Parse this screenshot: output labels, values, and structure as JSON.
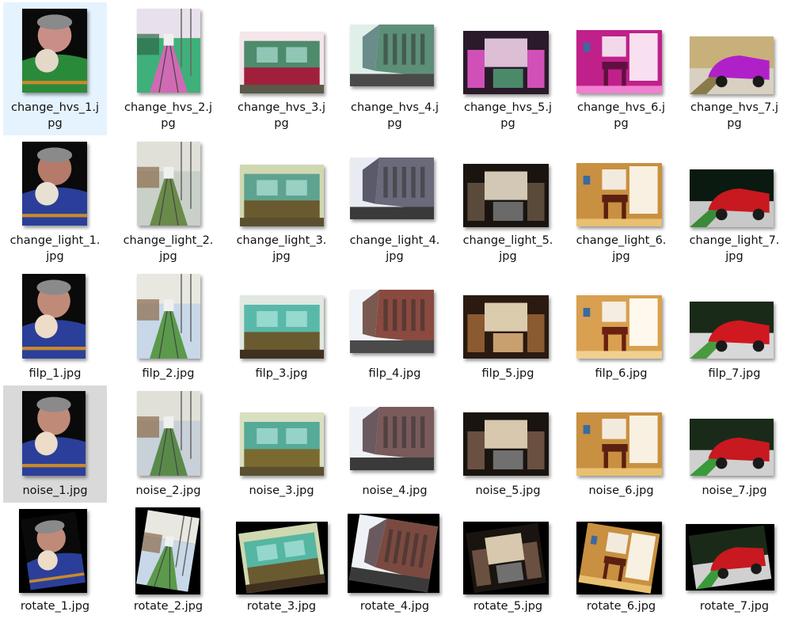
{
  "files": [
    {
      "name": "change_hvs_1.j\npg",
      "selected": true,
      "hover": false,
      "thumb": {
        "type": "portrait",
        "colors": [
          "#0a0a0a",
          "#2a8a3a",
          "#c98f86",
          "#e4d8c8"
        ]
      }
    },
    {
      "name": "change_hvs_2.j\npg",
      "selected": false,
      "hover": false,
      "thumb": {
        "type": "railway",
        "colors": [
          "#3fb07a",
          "#d06ab4",
          "#2f6a4a",
          "#e8e0ea"
        ]
      }
    },
    {
      "name": "change_hvs_3.j\npg",
      "selected": false,
      "hover": false,
      "thumb": {
        "type": "house",
        "colors": [
          "#f4e6ea",
          "#a0203c",
          "#2f7a56",
          "#5a5a4a"
        ]
      }
    },
    {
      "name": "change_hvs_4.j\npg",
      "selected": false,
      "hover": false,
      "thumb": {
        "type": "street",
        "colors": [
          "#dff0e8",
          "#5d8f78",
          "#6a8c8a",
          "#4a4a4a"
        ]
      }
    },
    {
      "name": "change_hvs_5.j\npg",
      "selected": false,
      "hover": false,
      "thumb": {
        "type": "room",
        "colors": [
          "#2a1a2a",
          "#d050b8",
          "#f0d0e8",
          "#4a8a6a"
        ]
      }
    },
    {
      "name": "change_hvs_6.j\npg",
      "selected": false,
      "hover": false,
      "thumb": {
        "type": "dining",
        "colors": [
          "#c0208a",
          "#f080d0",
          "#f8e0f0",
          "#601040"
        ]
      }
    },
    {
      "name": "change_hvs_7.j\npg",
      "selected": false,
      "hover": false,
      "thumb": {
        "type": "car",
        "colors": [
          "#c8b07a",
          "#b020c8",
          "#8a7a4a",
          "#d8d0c0"
        ]
      }
    },
    {
      "name": "change_light_1.\njpg",
      "selected": false,
      "hover": false,
      "thumb": {
        "type": "portrait",
        "colors": [
          "#0a0a0a",
          "#2b3f9a",
          "#b57a6a",
          "#e8e0d0"
        ]
      }
    },
    {
      "name": "change_light_2.\njpg",
      "selected": false,
      "hover": false,
      "thumb": {
        "type": "railway",
        "colors": [
          "#c8d0c8",
          "#6a8a4a",
          "#8a6a4a",
          "#e0e0d8"
        ]
      }
    },
    {
      "name": "change_light_3.\njpg",
      "selected": false,
      "hover": false,
      "thumb": {
        "type": "house",
        "colors": [
          "#d0d8b0",
          "#6a5a30",
          "#4a9a8a",
          "#5a5030"
        ]
      }
    },
    {
      "name": "change_light_4.\njpg",
      "selected": false,
      "hover": false,
      "thumb": {
        "type": "street",
        "colors": [
          "#e8ecf2",
          "#6a6a7a",
          "#5a5a6a",
          "#3a3a3a"
        ]
      }
    },
    {
      "name": "change_light_5.\njpg",
      "selected": false,
      "hover": false,
      "thumb": {
        "type": "room",
        "colors": [
          "#1a1410",
          "#5a4a3a",
          "#e8dcc8",
          "#6a6a6a"
        ]
      }
    },
    {
      "name": "change_light_6.\njpg",
      "selected": false,
      "hover": false,
      "thumb": {
        "type": "dining",
        "colors": [
          "#c89040",
          "#e8c070",
          "#f8f0e0",
          "#5a2010"
        ]
      }
    },
    {
      "name": "change_light_7.\njpg",
      "selected": false,
      "hover": false,
      "thumb": {
        "type": "car",
        "colors": [
          "#0a1a10",
          "#c81820",
          "#3a8a3a",
          "#c8c8c8"
        ]
      }
    },
    {
      "name": "filp_1.jpg",
      "selected": false,
      "hover": false,
      "thumb": {
        "type": "portrait",
        "colors": [
          "#0a0a0a",
          "#2b3f9a",
          "#c08a78",
          "#ecdcc8"
        ]
      }
    },
    {
      "name": "filp_2.jpg",
      "selected": false,
      "hover": false,
      "thumb": {
        "type": "railway",
        "colors": [
          "#c8d8e8",
          "#5a9a4a",
          "#8a6a4a",
          "#e8e8e0"
        ]
      }
    },
    {
      "name": "filp_3.jpg",
      "selected": false,
      "hover": false,
      "thumb": {
        "type": "house",
        "colors": [
          "#e0e8e0",
          "#6a5a30",
          "#40b0a0",
          "#403020"
        ]
      }
    },
    {
      "name": "filp_4.jpg",
      "selected": false,
      "hover": false,
      "thumb": {
        "type": "street",
        "colors": [
          "#f0f4f8",
          "#8a4a40",
          "#7a5a50",
          "#4a4a4a"
        ]
      }
    },
    {
      "name": "filp_5.jpg",
      "selected": false,
      "hover": false,
      "thumb": {
        "type": "room",
        "colors": [
          "#2a1a10",
          "#8a5a30",
          "#f0e0c0",
          "#c8a070"
        ]
      }
    },
    {
      "name": "filp_6.jpg",
      "selected": false,
      "hover": false,
      "thumb": {
        "type": "dining",
        "colors": [
          "#d8a050",
          "#f0d090",
          "#fff8ec",
          "#6a2010"
        ]
      }
    },
    {
      "name": "filp_7.jpg",
      "selected": false,
      "hover": false,
      "thumb": {
        "type": "car",
        "colors": [
          "#1a2a18",
          "#d01820",
          "#4a9a40",
          "#d8d8d8"
        ]
      }
    },
    {
      "name": "noise_1.jpg",
      "selected": false,
      "hover": true,
      "thumb": {
        "type": "portrait",
        "colors": [
          "#0a0a0a",
          "#2b3f9a",
          "#c08a78",
          "#ecdcc8"
        ]
      }
    },
    {
      "name": "noise_2.jpg",
      "selected": false,
      "hover": false,
      "thumb": {
        "type": "railway",
        "colors": [
          "#c8d0d8",
          "#5a8a4a",
          "#8a6a4a",
          "#e0e0d8"
        ]
      }
    },
    {
      "name": "noise_3.jpg",
      "selected": false,
      "hover": false,
      "thumb": {
        "type": "house",
        "colors": [
          "#d8e0c0",
          "#7a6a30",
          "#40a090",
          "#5a5030"
        ]
      }
    },
    {
      "name": "noise_4.jpg",
      "selected": false,
      "hover": false,
      "thumb": {
        "type": "street",
        "colors": [
          "#eef2f6",
          "#7a5a5a",
          "#6a5a60",
          "#3a3a3a"
        ]
      }
    },
    {
      "name": "noise_5.jpg",
      "selected": false,
      "hover": false,
      "thumb": {
        "type": "room",
        "colors": [
          "#1a1410",
          "#6a5040",
          "#ecdcc0",
          "#707070"
        ]
      }
    },
    {
      "name": "noise_6.jpg",
      "selected": false,
      "hover": false,
      "thumb": {
        "type": "dining",
        "colors": [
          "#c89040",
          "#e8c070",
          "#f8f0e0",
          "#5a2010"
        ]
      }
    },
    {
      "name": "noise_7.jpg",
      "selected": false,
      "hover": false,
      "thumb": {
        "type": "car",
        "colors": [
          "#1a2a18",
          "#c81820",
          "#3a9a3a",
          "#d0d0d0"
        ]
      }
    },
    {
      "name": "rotate_1.jpg",
      "selected": false,
      "hover": false,
      "thumb": {
        "type": "portrait",
        "colors": [
          "#0a0a0a",
          "#2b3f9a",
          "#c08a78",
          "#ecdcc8"
        ]
      }
    },
    {
      "name": "rotate_2.jpg",
      "selected": false,
      "hover": false,
      "thumb": {
        "type": "railway",
        "colors": [
          "#c8d8e8",
          "#5a9a4a",
          "#8a6a4a",
          "#e8e8e0"
        ]
      }
    },
    {
      "name": "rotate_3.jpg",
      "selected": false,
      "hover": false,
      "thumb": {
        "type": "house",
        "colors": [
          "#d0d8b0",
          "#6a5a30",
          "#40b0a0",
          "#403020"
        ]
      }
    },
    {
      "name": "rotate_4.jpg",
      "selected": false,
      "hover": false,
      "thumb": {
        "type": "street",
        "colors": [
          "#eef2f6",
          "#7a4a40",
          "#6a5a60",
          "#3a3a3a"
        ]
      }
    },
    {
      "name": "rotate_5.jpg",
      "selected": false,
      "hover": false,
      "thumb": {
        "type": "room",
        "colors": [
          "#1a1410",
          "#6a5040",
          "#ecdcc0",
          "#707070"
        ]
      }
    },
    {
      "name": "rotate_6.jpg",
      "selected": false,
      "hover": false,
      "thumb": {
        "type": "dining",
        "colors": [
          "#c89040",
          "#e8c070",
          "#f8f0e0",
          "#5a2010"
        ]
      }
    },
    {
      "name": "rotate_7.jpg",
      "selected": false,
      "hover": false,
      "thumb": {
        "type": "car",
        "colors": [
          "#1a2a18",
          "#c81820",
          "#3a9a3a",
          "#d0d0d0"
        ]
      }
    }
  ]
}
